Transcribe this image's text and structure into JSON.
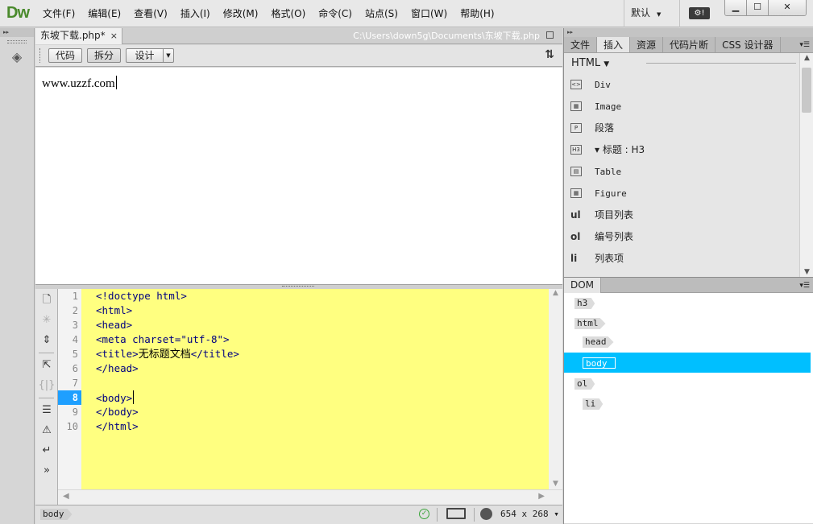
{
  "app": {
    "logo": "Dw",
    "menu": [
      "文件(F)",
      "编辑(E)",
      "查看(V)",
      "插入(I)",
      "修改(M)",
      "格式(O)",
      "命令(C)",
      "站点(S)",
      "窗口(W)",
      "帮助(H)"
    ],
    "workspace": "默认"
  },
  "document": {
    "tab_label": "东坡下载.php*",
    "tab_close": "×",
    "path": "C:\\Users\\down5g\\Documents\\东坡下载.php",
    "views": {
      "code": "代码",
      "split": "拆分",
      "design": "设计"
    },
    "design_text": "www.uzzf.com"
  },
  "code": {
    "line_numbers": [
      "1",
      "2",
      "3",
      "4",
      "5",
      "6",
      "7",
      "8",
      "9",
      "10"
    ],
    "current_line": "8",
    "lines": {
      "l1": "<!doctype html>",
      "l2": "<html>",
      "l3": "<head>",
      "l4": "<meta charset=\"utf-8\">",
      "l5_open": "<title>",
      "l5_text": "无标题文档",
      "l5_close": "</title>",
      "l6": "</head>",
      "l7": "",
      "l8": "<body>",
      "l9": "</body>",
      "l10": "</html>"
    }
  },
  "statusbar": {
    "tag": "body",
    "size": "654 x 268",
    "size_chevron": "▾"
  },
  "insert_panel": {
    "tabs": [
      "文件",
      "插入",
      "资源",
      "代码片断",
      "CSS 设计器"
    ],
    "active_tab": "插入",
    "category": "HTML",
    "items": [
      {
        "icon": "<>",
        "label": "Div"
      },
      {
        "icon": "▦",
        "label": "Image"
      },
      {
        "icon": "P",
        "label": "段落"
      },
      {
        "icon": "H3",
        "label": "▾ 标题 : H3"
      },
      {
        "icon": "▤",
        "label": "Table"
      },
      {
        "icon": "▦",
        "label": "Figure"
      },
      {
        "icon": "ul",
        "label": "项目列表"
      },
      {
        "icon": "ol",
        "label": "编号列表"
      },
      {
        "icon": "li",
        "label": "列表项"
      }
    ]
  },
  "dom_panel": {
    "tab": "DOM",
    "nodes": [
      {
        "tag": "h3",
        "selected": false
      },
      {
        "tag": "html",
        "selected": false
      },
      {
        "tag": "head",
        "selected": false
      },
      {
        "tag": "body",
        "selected": true
      },
      {
        "tag": "ol",
        "selected": false
      },
      {
        "tag": "li",
        "selected": false
      }
    ],
    "selection_color": "#00bfff"
  },
  "colors": {
    "code_background": "#ffff80",
    "current_line": "#1e9fff",
    "logo": "#4a8a2c"
  }
}
